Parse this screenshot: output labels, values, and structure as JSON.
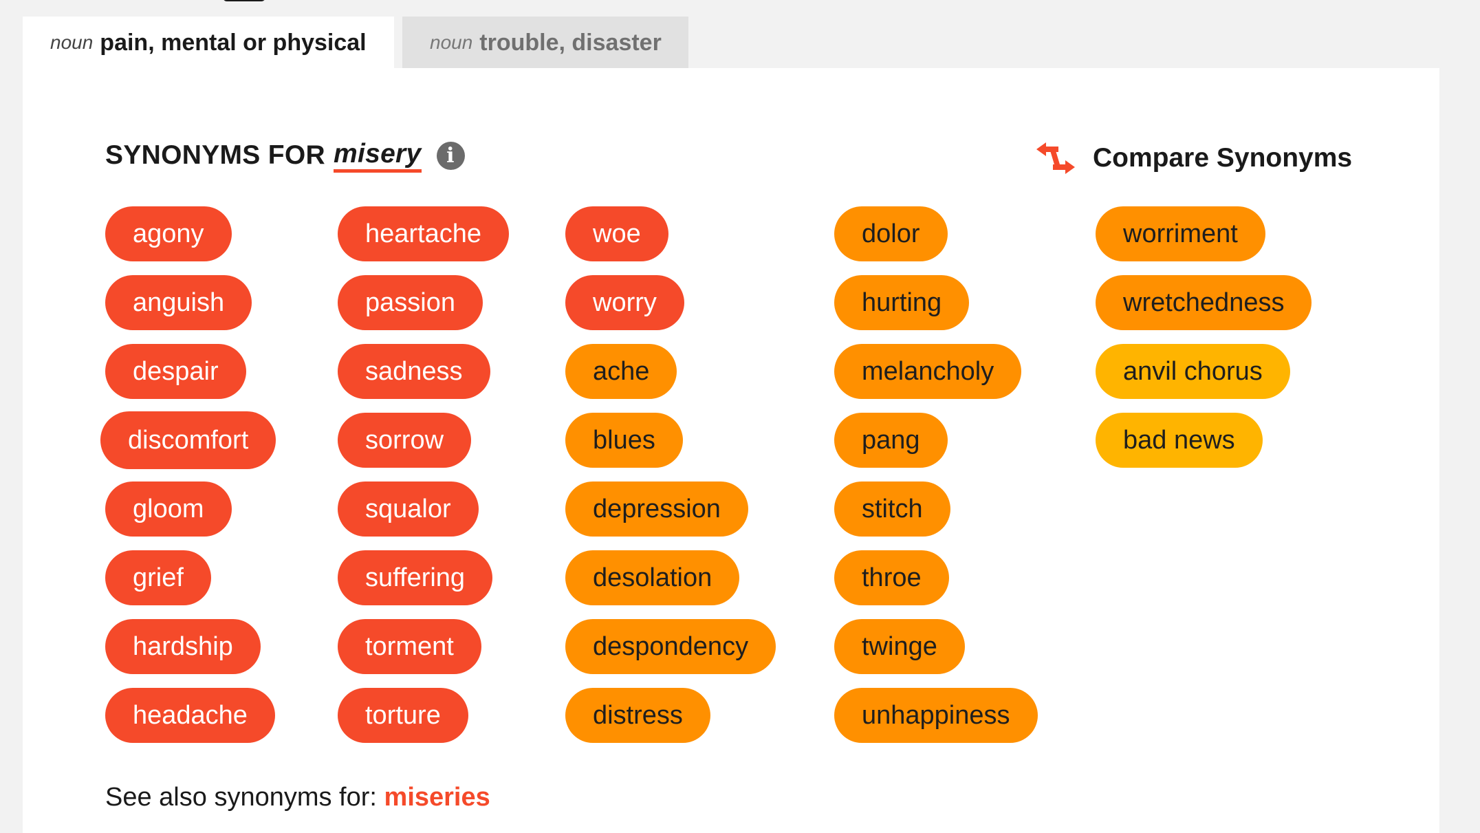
{
  "tabs": [
    {
      "pos": "noun",
      "definition": "pain, mental or physical",
      "active": true
    },
    {
      "pos": "noun",
      "definition": "trouble, disaster",
      "active": false
    }
  ],
  "header": {
    "prefix": "SYNONYMS FOR",
    "word": "misery",
    "info_icon": "info-icon"
  },
  "compare": {
    "label": "Compare Synonyms",
    "icon": "swap-arrows-icon"
  },
  "colors": {
    "red": "#f54a2a",
    "orange": "#ff9000",
    "yellow": "#ffb400",
    "panel": "#ffffff",
    "background": "#f2f2f2"
  },
  "columns": [
    [
      {
        "word": "agony",
        "tone": "red"
      },
      {
        "word": "anguish",
        "tone": "red"
      },
      {
        "word": "despair",
        "tone": "red"
      },
      {
        "word": "discomfort",
        "tone": "red"
      },
      {
        "word": "gloom",
        "tone": "red"
      },
      {
        "word": "grief",
        "tone": "red"
      },
      {
        "word": "hardship",
        "tone": "red"
      },
      {
        "word": "headache",
        "tone": "red"
      }
    ],
    [
      {
        "word": "heartache",
        "tone": "red"
      },
      {
        "word": "passion",
        "tone": "red"
      },
      {
        "word": "sadness",
        "tone": "red"
      },
      {
        "word": "sorrow",
        "tone": "red"
      },
      {
        "word": "squalor",
        "tone": "red"
      },
      {
        "word": "suffering",
        "tone": "red"
      },
      {
        "word": "torment",
        "tone": "red"
      },
      {
        "word": "torture",
        "tone": "red"
      }
    ],
    [
      {
        "word": "woe",
        "tone": "red"
      },
      {
        "word": "worry",
        "tone": "red"
      },
      {
        "word": "ache",
        "tone": "orange"
      },
      {
        "word": "blues",
        "tone": "orange"
      },
      {
        "word": "depression",
        "tone": "orange"
      },
      {
        "word": "desolation",
        "tone": "orange"
      },
      {
        "word": "despondency",
        "tone": "orange"
      },
      {
        "word": "distress",
        "tone": "orange"
      }
    ],
    [
      {
        "word": "dolor",
        "tone": "orange"
      },
      {
        "word": "hurting",
        "tone": "orange"
      },
      {
        "word": "melancholy",
        "tone": "orange"
      },
      {
        "word": "pang",
        "tone": "orange"
      },
      {
        "word": "stitch",
        "tone": "orange"
      },
      {
        "word": "throe",
        "tone": "orange"
      },
      {
        "word": "twinge",
        "tone": "orange"
      },
      {
        "word": "unhappiness",
        "tone": "orange"
      }
    ],
    [
      {
        "word": "worriment",
        "tone": "orange"
      },
      {
        "word": "wretchedness",
        "tone": "orange"
      },
      {
        "word": "anvil chorus",
        "tone": "yellow"
      },
      {
        "word": "bad news",
        "tone": "yellow"
      }
    ]
  ],
  "see_also": {
    "label": "See also synonyms for:",
    "link": "miseries"
  }
}
